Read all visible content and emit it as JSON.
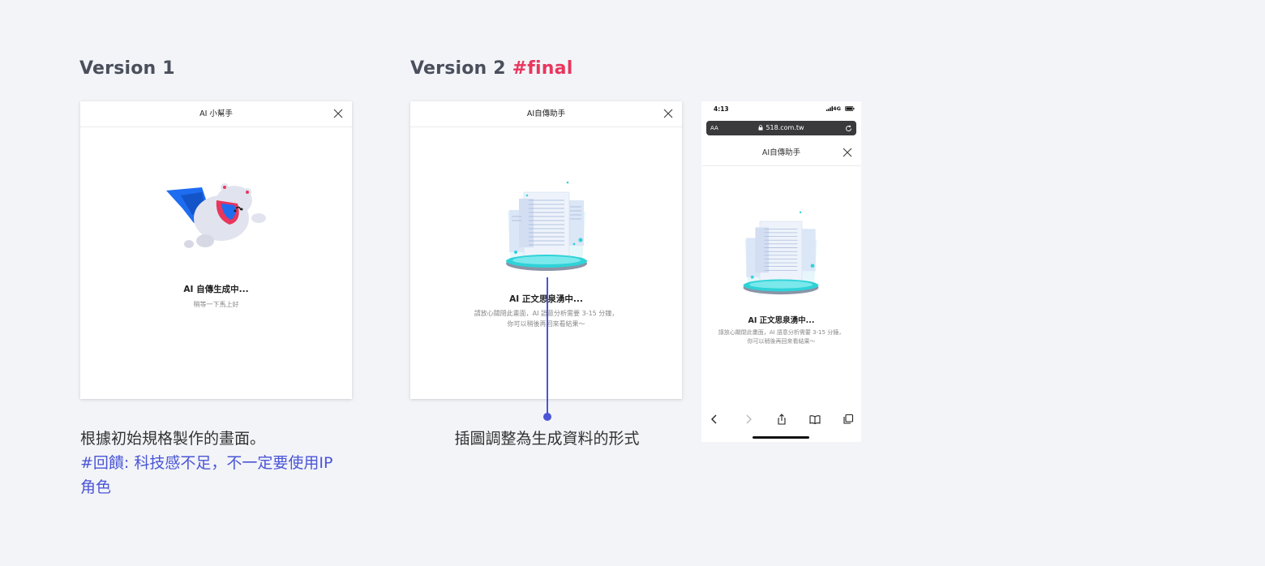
{
  "version1": {
    "heading": "Version 1",
    "dialog_title": "AI 小幫手",
    "status_title": "AI 自傳生成中...",
    "status_sub": "稍等一下馬上好",
    "caption_line1": "根據初始規格製作的畫面。",
    "feedback": "#回饋: 科技感不足，不一定要使用IP角色"
  },
  "version2": {
    "heading": "Version 2",
    "final_tag": "#final",
    "dialog_title": "AI自傳助手",
    "status_title": "AI 正文思泉湧中...",
    "status_sub_line1": "請放心關閉此畫面，AI 語意分析需要 3-15 分鐘，",
    "status_sub_line2": "你可以稍後再回來看結果～",
    "caption": "插圖調整為生成資料的形式"
  },
  "phone": {
    "time": "4:13",
    "network": "4G",
    "aa": "AA",
    "url": "518.com.tw",
    "dialog_title": "AI自傳助手",
    "status_title": "AI 正文思泉湧中...",
    "status_sub_line1": "請放心關閉此畫面，AI 語意分析需要 3-15 分鐘，",
    "status_sub_line2": "你可以稍後再回來看結果～"
  },
  "colors": {
    "accent_final": "#e8365d",
    "feedback": "#4b55d6",
    "connector": "#4b55d6",
    "platform": "#2fd3d8"
  }
}
